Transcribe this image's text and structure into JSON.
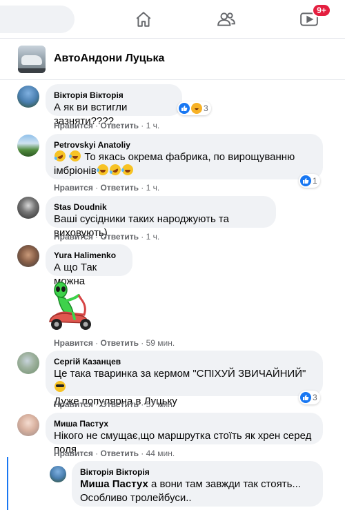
{
  "nav": {
    "notification_badge": "9+",
    "icons": [
      "home-icon",
      "friends-icon",
      "watch-icon"
    ]
  },
  "group": {
    "name": "АвтоАндони Луцька"
  },
  "comments": [
    {
      "author": "Вікторія Вікторія",
      "text": "А як ви встигли зазняти????",
      "like_label": "Нравится",
      "reply_label": "Ответить",
      "time": "1 ч.",
      "reaction_count": "3",
      "reactions": [
        "like",
        "haha"
      ]
    },
    {
      "author": "Petrovskyi Anatoliy",
      "text_line1": "То якась окрема фабрика, по вирощуванню",
      "text_line2": "імбріонів",
      "like_label": "Нравится",
      "reply_label": "Ответить",
      "time": "1 ч.",
      "reaction_count": "1",
      "reactions": [
        "like"
      ]
    },
    {
      "author": "Stas Doudnik",
      "text": "Ваші сусідники таких народжують та виховують)",
      "like_label": "Нравится",
      "reply_label": "Ответить",
      "time": "1 ч."
    },
    {
      "author": "Yura Halimenko",
      "text": "А що Так можна",
      "sticker": "alien-on-scooter-sticker",
      "like_label": "Нравится",
      "reply_label": "Ответить",
      "time": "59 мин."
    },
    {
      "author": "Сергій Казанцев",
      "text_line1": "Це така тваринка за кермом \"СПІХУЙ ЗВИЧАЙНИЙ\"",
      "text_line2": "Дуже популярна в Луцьку",
      "like_label": "Нравится",
      "reply_label": "Ответить",
      "time": "57 мин.",
      "reaction_count": "3",
      "reactions": [
        "like"
      ]
    },
    {
      "author": "Миша Пастух",
      "text": "Нікого не смущає,що маршрутка стоїть як хрен серед поля",
      "like_label": "Нравится",
      "reply_label": "Ответить",
      "time": "44 мин."
    }
  ],
  "reply": {
    "author": "Вікторія Вікторія",
    "mention": "Миша Пастух",
    "text_line1": "а вони там завжди так стоять...",
    "text_line2": "Особливо тролейбуси.."
  },
  "colors": {
    "brand_blue": "#1877f2",
    "badge_red": "#e41e3f",
    "bubble_gray": "#f0f2f5",
    "meta_gray": "#65676b"
  }
}
